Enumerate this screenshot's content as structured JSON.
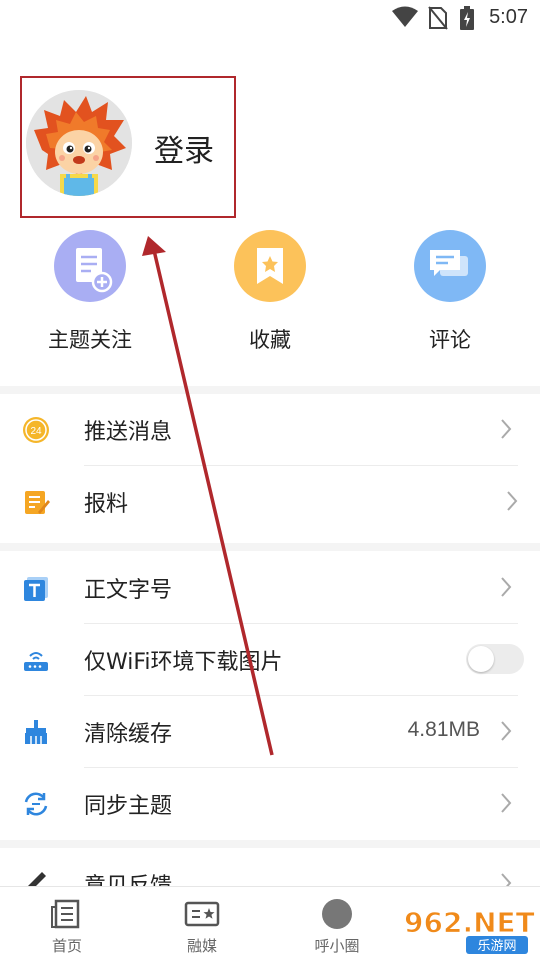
{
  "status_bar": {
    "time": "5:07",
    "icons": [
      "wifi-icon",
      "no-sim-icon",
      "battery-charging-icon"
    ]
  },
  "profile": {
    "login_label": "登录",
    "avatar": "lion-mascot-avatar"
  },
  "quick_actions": [
    {
      "label": "主题关注",
      "icon": "topic-follow-icon",
      "color": "#a9aef3"
    },
    {
      "label": "收藏",
      "icon": "bookmark-icon",
      "color": "#fcc25a"
    },
    {
      "label": "评论",
      "icon": "comment-icon",
      "color": "#7fb8f5"
    }
  ],
  "menu_group_1": [
    {
      "label": "推送消息",
      "icon": "push-24-icon"
    },
    {
      "label": "报料",
      "icon": "report-note-icon"
    }
  ],
  "menu_group_2": [
    {
      "label": "正文字号",
      "icon": "font-size-icon"
    },
    {
      "label": "仅WiFi环境下载图片",
      "icon": "router-icon",
      "toggle_on": false
    },
    {
      "label": "清除缓存",
      "icon": "broom-icon",
      "value": "4.81MB"
    },
    {
      "label": "同步主题",
      "icon": "sync-icon"
    }
  ],
  "menu_partial": {
    "label": "意见反馈",
    "icon": "pencil-icon"
  },
  "bottom_nav": [
    {
      "label": "首页",
      "icon": "newspaper-icon"
    },
    {
      "label": "融媒",
      "icon": "media-card-icon"
    },
    {
      "label": "呼小圈",
      "icon": "circle-icon"
    }
  ],
  "watermark": {
    "brand": "962.NET",
    "sub": "乐游网"
  },
  "colors": {
    "annotation_red": "#b0282c",
    "orange": "#f5a623",
    "blue": "#3b8fe6",
    "text": "#222222"
  }
}
